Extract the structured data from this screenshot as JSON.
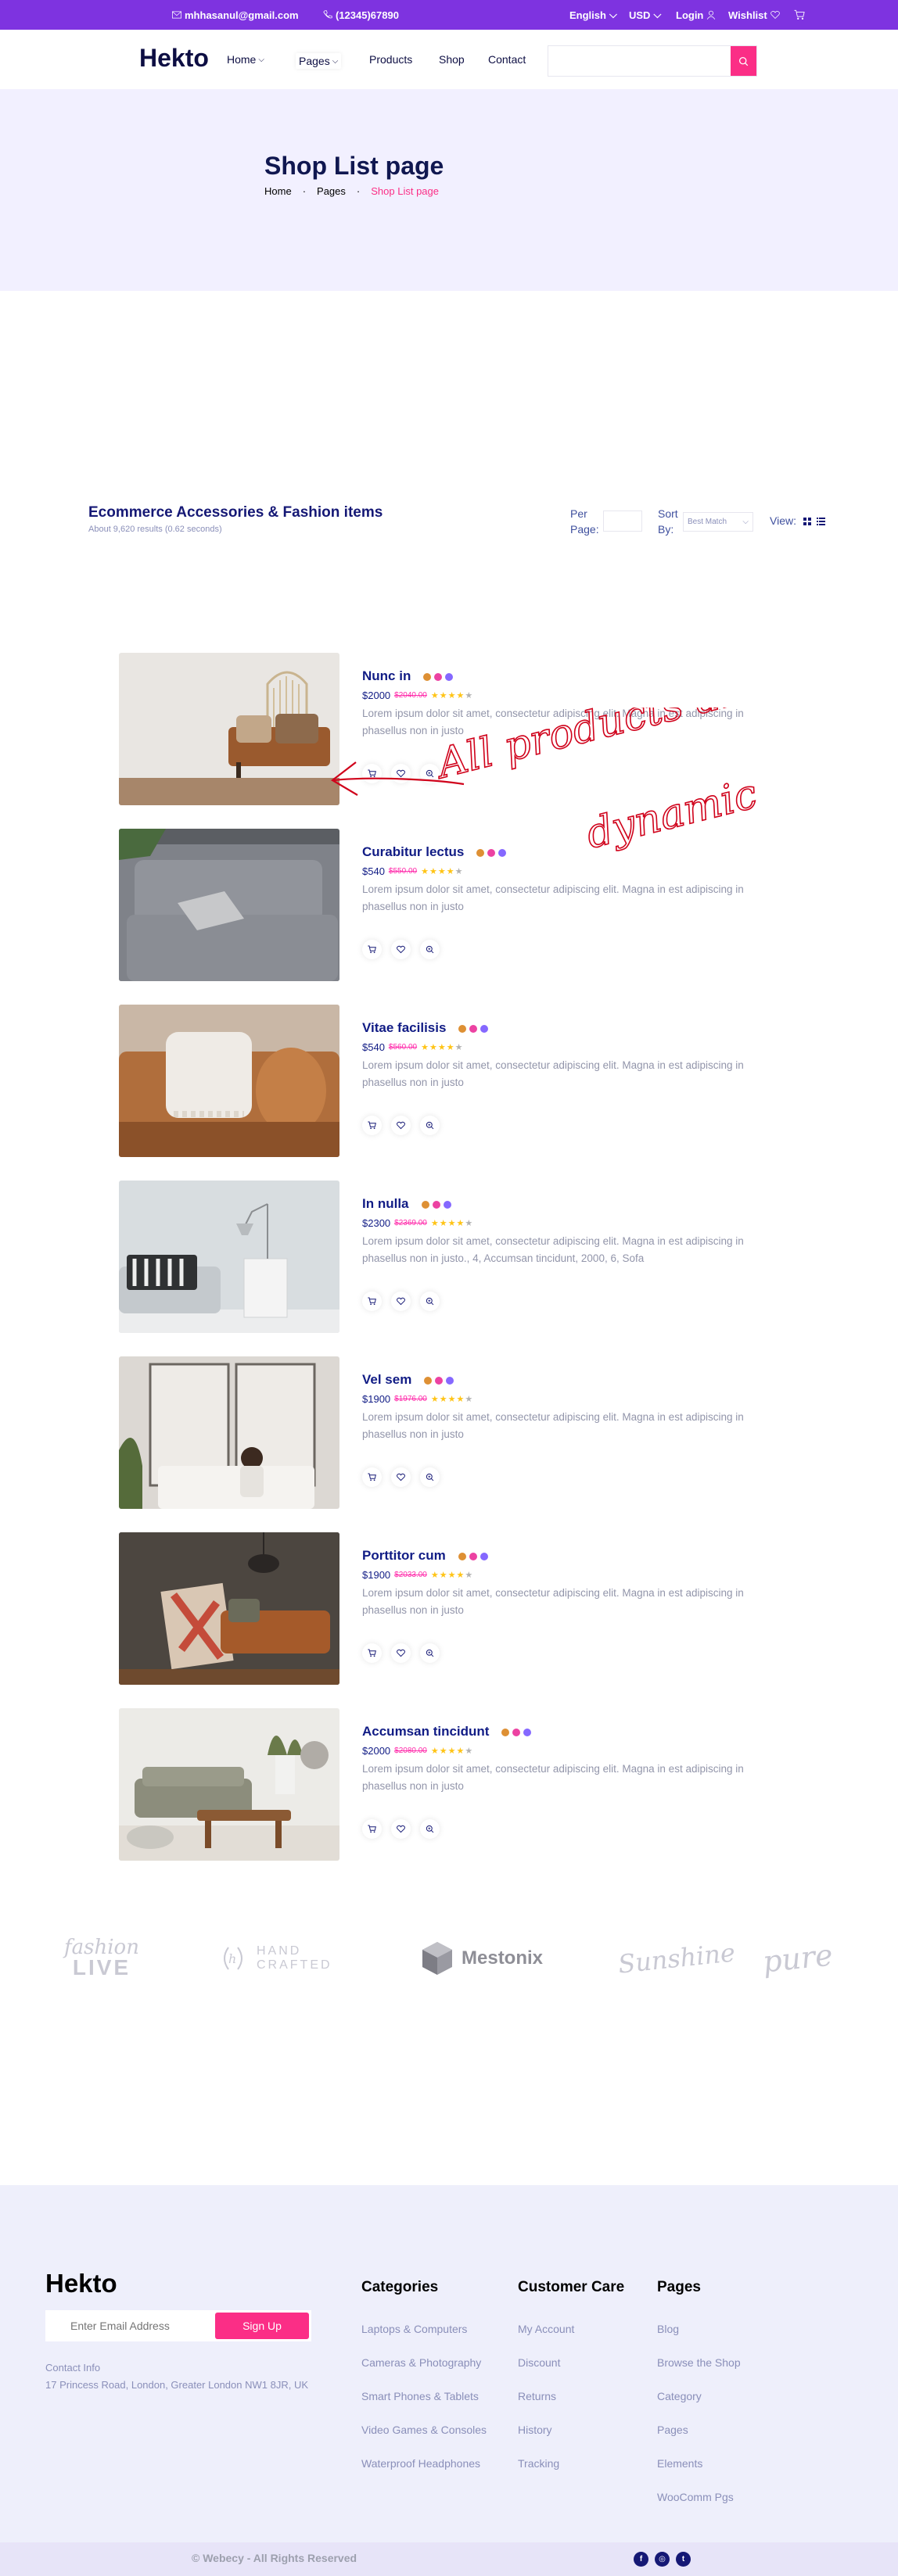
{
  "topbar": {
    "email": "mhhasanul@gmail.com",
    "phone": "(12345)67890",
    "language": "English",
    "currency": "USD",
    "login": "Login",
    "wishlist": "Wishlist",
    "bg_color": "#7e33e0"
  },
  "header": {
    "logo": "Hekto",
    "nav": [
      {
        "label": "Home",
        "has_dropdown": true
      },
      {
        "label": "Pages",
        "has_dropdown": true
      },
      {
        "label": "Products"
      },
      {
        "label": "Shop"
      },
      {
        "label": "Contact"
      }
    ],
    "search_placeholder": "",
    "accent_color": "#fb2e86"
  },
  "hero": {
    "title": "Shop List page",
    "breadcrumbs": [
      "Home",
      "Pages",
      "Shop List page"
    ]
  },
  "toolbar": {
    "title": "Ecommerce Accessories & Fashion items",
    "subtitle": "About 9,620 results (0.62 seconds)",
    "per_page_label": "Per Page:",
    "sort_label": "Sort By:",
    "sort_value": "Best Match",
    "view_label": "View:"
  },
  "products": [
    {
      "name": "Nunc in",
      "price": "$2000",
      "old_price": "$2040.00",
      "rating": 4,
      "desc": "Lorem ipsum dolor sit amet, consectetur adipiscing elit. Magna in est adipiscing in phasellus non in justo"
    },
    {
      "name": "Curabitur lectus",
      "price": "$540",
      "old_price": "$550.00",
      "rating": 4,
      "desc": "Lorem ipsum dolor sit amet, consectetur adipiscing elit. Magna in est adipiscing in phasellus non in justo"
    },
    {
      "name": "Vitae facilisis",
      "price": "$540",
      "old_price": "$560.00",
      "rating": 4,
      "desc": "Lorem ipsum dolor sit amet, consectetur adipiscing elit. Magna in est adipiscing in phasellus non in justo"
    },
    {
      "name": "In nulla",
      "price": "$2300",
      "old_price": "$2369.00",
      "rating": 4,
      "desc": "Lorem ipsum dolor sit amet, consectetur adipiscing elit. Magna in est adipiscing in phasellus non in justo., 4, Accumsan tincidunt, 2000, 6, Sofa"
    },
    {
      "name": "Vel sem",
      "price": "$1900",
      "old_price": "$1976.00",
      "rating": 4,
      "desc": "Lorem ipsum dolor sit amet, consectetur adipiscing elit. Magna in est adipiscing in phasellus non in justo"
    },
    {
      "name": "Porttitor cum",
      "price": "$1900",
      "old_price": "$2033.00",
      "rating": 4,
      "desc": "Lorem ipsum dolor sit amet, consectetur adipiscing elit. Magna in est adipiscing in phasellus non in justo"
    },
    {
      "name": "Accumsan tincidunt",
      "price": "$2000",
      "old_price": "$2080.00",
      "rating": 4,
      "desc": "Lorem ipsum dolor sit amet, consectetur adipiscing elit. Magna in est adipiscing in phasellus non in justo"
    }
  ],
  "swatch_colors": [
    "#de9034",
    "#ec42a2",
    "#8568ff"
  ],
  "annotation": {
    "text_line1": "All products are",
    "text_line2": "dynamic",
    "color": "#d0021b"
  },
  "brands": [
    {
      "line1": "fashion",
      "line2": "LIVE"
    },
    {
      "line1": "HAND",
      "line2": "CRAFTED"
    },
    {
      "name": "Mestonix"
    },
    {
      "name": "Sunshine"
    },
    {
      "name": "pure"
    }
  ],
  "footer": {
    "logo": "Hekto",
    "email_placeholder": "Enter Email Address",
    "signup": "Sign Up",
    "contact_title": "Contact Info",
    "address": "17 Princess Road, London, Greater London NW1 8JR, UK",
    "columns": [
      {
        "title": "Categories",
        "links": [
          "Laptops & Computers",
          "Cameras & Photography",
          "Smart Phones & Tablets",
          "Video Games & Consoles",
          "Waterproof Headphones"
        ]
      },
      {
        "title": "Customer Care",
        "links": [
          "My Account",
          "Discount",
          "Returns",
          "History",
          "Tracking"
        ]
      },
      {
        "title": "Pages",
        "links": [
          "Blog",
          "Browse the Shop",
          "Category",
          "Pages",
          "Elements",
          "WooComm Pgs"
        ]
      }
    ],
    "copyright": "© Webecy - All Rights Reserved",
    "social": [
      "facebook-icon",
      "instagram-icon",
      "twitter-icon"
    ]
  }
}
